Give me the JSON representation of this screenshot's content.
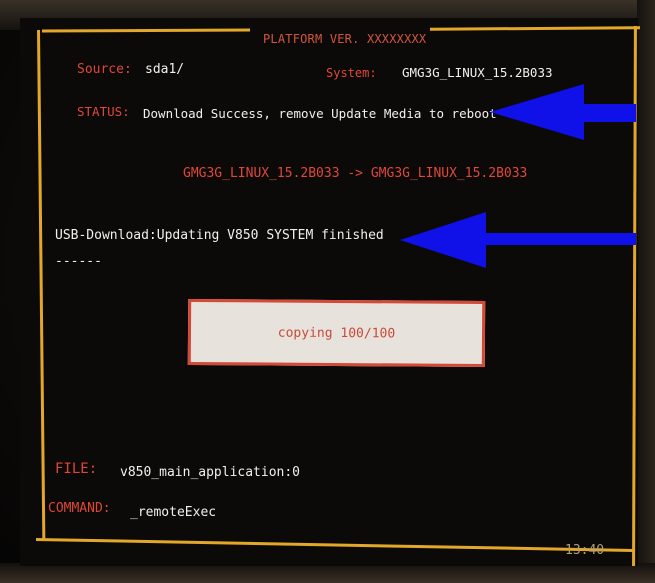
{
  "header": {
    "title": "PLATFORM VER. XXXXXXXX"
  },
  "info": {
    "source_label": "Source:",
    "source_value": "sda1/",
    "system_label": "System:",
    "system_value": "GMG3G_LINUX_15.2B033",
    "status_label": "STATUS:",
    "status_value": "Download Success, remove Update Media to reboot"
  },
  "version_change": "GMG3G_LINUX_15.2B033 -> GMG3G_LINUX_15.2B033",
  "usb_message": "USB-Download:Updating V850 SYSTEM finished",
  "dashes": "------",
  "progress": {
    "text": "copying 100/100",
    "current": 100,
    "total": 100
  },
  "footer": {
    "file_label": "FILE:",
    "file_value": "v850_main_application:0",
    "command_label": "COMMAND:",
    "command_value": "_remoteExec",
    "clock": "13:40"
  },
  "colors": {
    "frame": "#e3a82a",
    "label_red": "#e0463a",
    "text_white": "#f2f0ec",
    "annotation_arrow": "#1010e8"
  },
  "icons": {
    "arrow_status": "arrow-left-icon",
    "arrow_usb": "arrow-left-icon"
  }
}
